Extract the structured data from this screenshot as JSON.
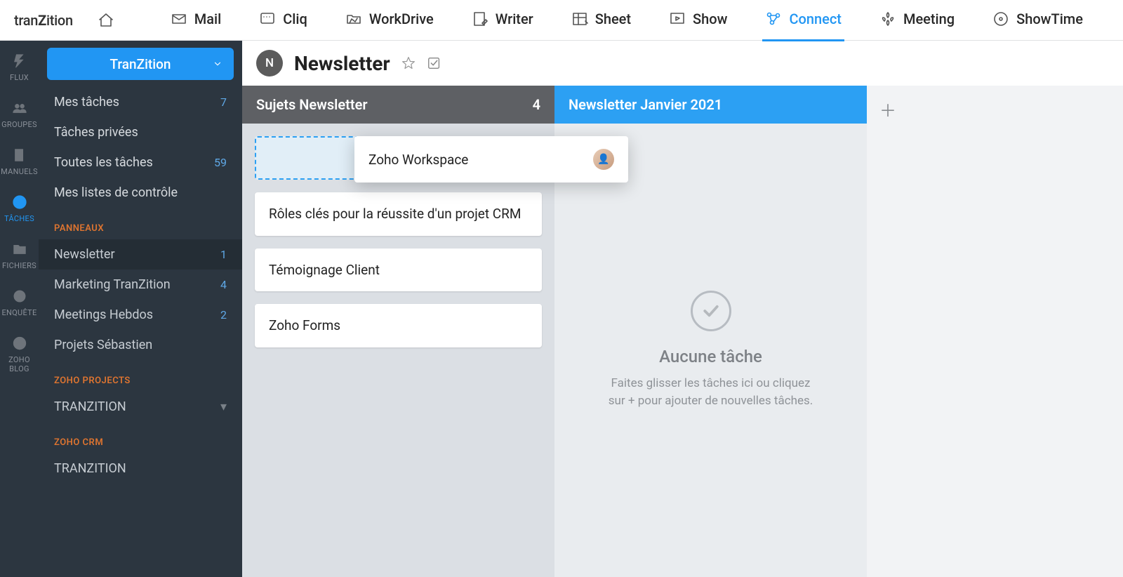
{
  "brand": {
    "pre": "tran",
    "z": "Z",
    "post": "ition"
  },
  "nav": [
    {
      "key": "mail",
      "label": "Mail"
    },
    {
      "key": "cliq",
      "label": "Cliq"
    },
    {
      "key": "workdrive",
      "label": "WorkDrive"
    },
    {
      "key": "writer",
      "label": "Writer"
    },
    {
      "key": "sheet",
      "label": "Sheet"
    },
    {
      "key": "show",
      "label": "Show"
    },
    {
      "key": "connect",
      "label": "Connect",
      "active": true
    },
    {
      "key": "meeting",
      "label": "Meeting"
    },
    {
      "key": "showtime",
      "label": "ShowTime"
    }
  ],
  "rail": [
    {
      "key": "flux",
      "label": "FLUX"
    },
    {
      "key": "groupes",
      "label": "GROUPES"
    },
    {
      "key": "manuels",
      "label": "MANUELS"
    },
    {
      "key": "taches",
      "label": "TÂCHES",
      "active": true
    },
    {
      "key": "fichiers",
      "label": "FICHIERS"
    },
    {
      "key": "enquete",
      "label": "ENQUÊTE"
    },
    {
      "key": "blog",
      "label": "ZOHO BLOG"
    }
  ],
  "sidebar": {
    "dropdown_label": "TranZition",
    "lists": [
      {
        "label": "Mes tâches",
        "count": "7"
      },
      {
        "label": "Tâches privées"
      },
      {
        "label": "Toutes les tâches",
        "count": "59"
      },
      {
        "label": "Mes listes de contrôle"
      }
    ],
    "sections": [
      {
        "heading": "PANNEAUX",
        "items": [
          {
            "label": "Newsletter",
            "count": "1",
            "active": true
          },
          {
            "label": "Marketing TranZition",
            "count": "4"
          },
          {
            "label": "Meetings Hebdos",
            "count": "2"
          },
          {
            "label": "Projets Sébastien"
          }
        ]
      },
      {
        "heading": "ZOHO PROJECTS",
        "items": [
          {
            "label": "TRANZITION",
            "chev": true
          }
        ]
      },
      {
        "heading": "ZOHO CRM",
        "items": [
          {
            "label": "TRANZITION"
          }
        ]
      }
    ]
  },
  "page": {
    "avatar_initial": "N",
    "title": "Newsletter"
  },
  "board": {
    "columns": [
      {
        "title": "Sujets Newsletter",
        "count": "4",
        "style": "gray",
        "drop_ghost": true,
        "dragging": {
          "label": "Zoho Workspace"
        },
        "cards": [
          {
            "label": "Rôles clés pour la réussite d'un projet CRM"
          },
          {
            "label": "Témoignage Client"
          },
          {
            "label": "Zoho Forms"
          }
        ]
      },
      {
        "title": "Newsletter Janvier 2021",
        "style": "blue",
        "empty": true
      }
    ],
    "empty_state": {
      "title": "Aucune tâche",
      "sub": "Faites glisser les tâches ici ou cliquez sur + pour ajouter de nouvelles tâches."
    }
  }
}
